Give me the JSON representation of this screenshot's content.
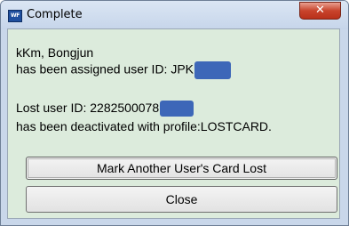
{
  "window": {
    "app_icon_text": "WF",
    "title": "Complete",
    "close_glyph": "✕"
  },
  "message": {
    "name_line": "kKm, Bongjun",
    "assigned_line": "has been assigned user ID: JPK",
    "lost_line": "Lost user ID: 2282500078",
    "deactivated_line": "has been deactivated with profile:LOSTCARD."
  },
  "buttons": {
    "mark_lost_label": "Mark Another User's Card Lost",
    "close_label": "Close"
  },
  "colors": {
    "dialog_background": "#dcebdc",
    "redaction_box": "#3d67b8",
    "titlebar_close": "#c8442c"
  }
}
